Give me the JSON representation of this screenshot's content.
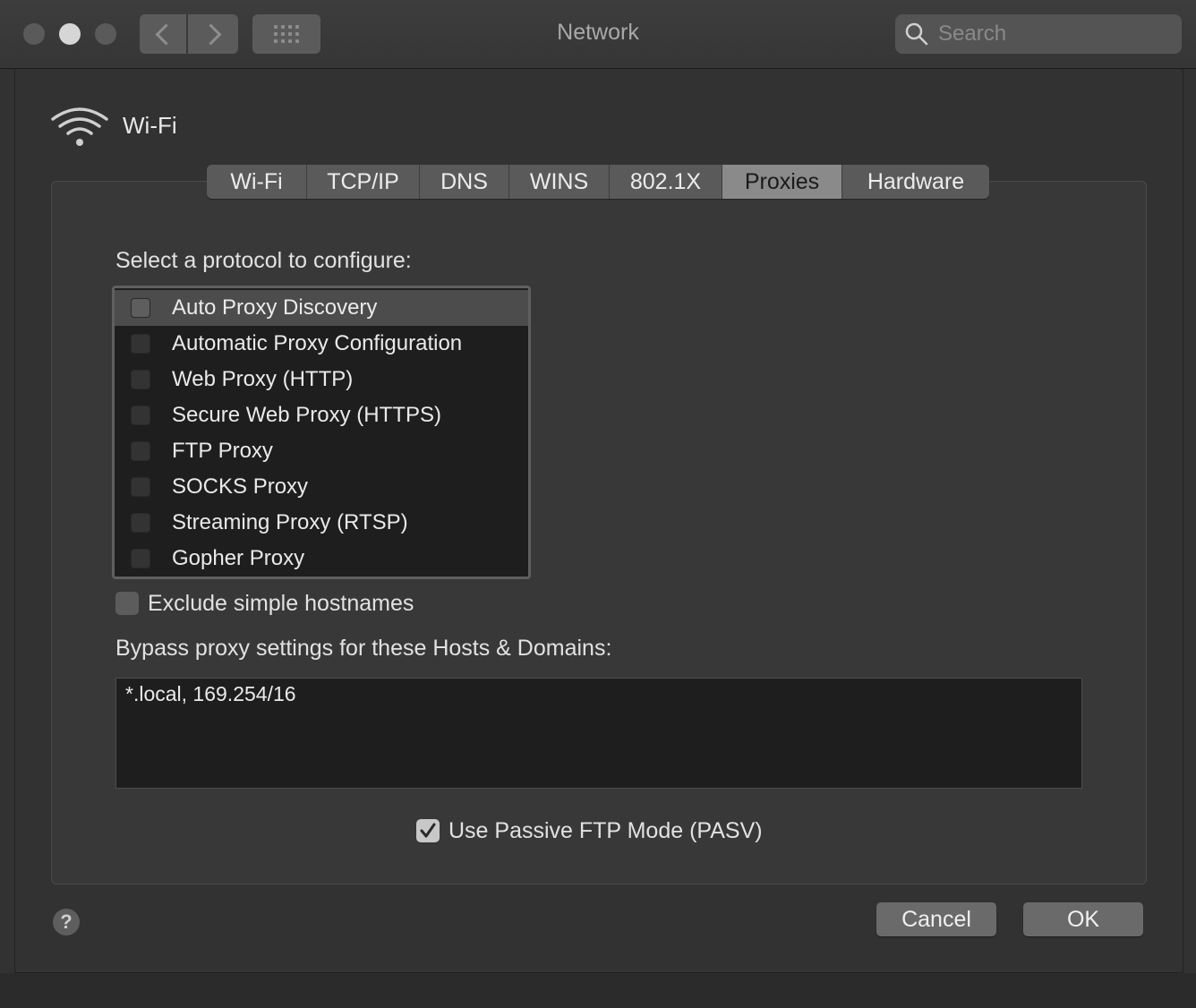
{
  "window": {
    "title": "Network"
  },
  "search": {
    "placeholder": "Search"
  },
  "header": {
    "service_name": "Wi-Fi"
  },
  "tabs": [
    {
      "label": "Wi-Fi"
    },
    {
      "label": "TCP/IP"
    },
    {
      "label": "DNS"
    },
    {
      "label": "WINS"
    },
    {
      "label": "802.1X"
    },
    {
      "label": "Proxies",
      "active": true
    },
    {
      "label": "Hardware"
    }
  ],
  "proxies": {
    "select_label": "Select a protocol to configure:",
    "protocols": [
      {
        "label": "Auto Proxy Discovery",
        "checked": false,
        "selected": true
      },
      {
        "label": "Automatic Proxy Configuration",
        "checked": false
      },
      {
        "label": "Web Proxy (HTTP)",
        "checked": false
      },
      {
        "label": "Secure Web Proxy (HTTPS)",
        "checked": false
      },
      {
        "label": "FTP Proxy",
        "checked": false
      },
      {
        "label": "SOCKS Proxy",
        "checked": false
      },
      {
        "label": "Streaming Proxy (RTSP)",
        "checked": false
      },
      {
        "label": "Gopher Proxy",
        "checked": false
      }
    ],
    "exclude_simple_label": "Exclude simple hostnames",
    "exclude_simple_checked": false,
    "bypass_label": "Bypass proxy settings for these Hosts & Domains:",
    "bypass_value": "*.local, 169.254/16",
    "passive_ftp_label": "Use Passive FTP Mode (PASV)",
    "passive_ftp_checked": true
  },
  "footer": {
    "help_label": "?",
    "cancel_label": "Cancel",
    "ok_label": "OK"
  }
}
